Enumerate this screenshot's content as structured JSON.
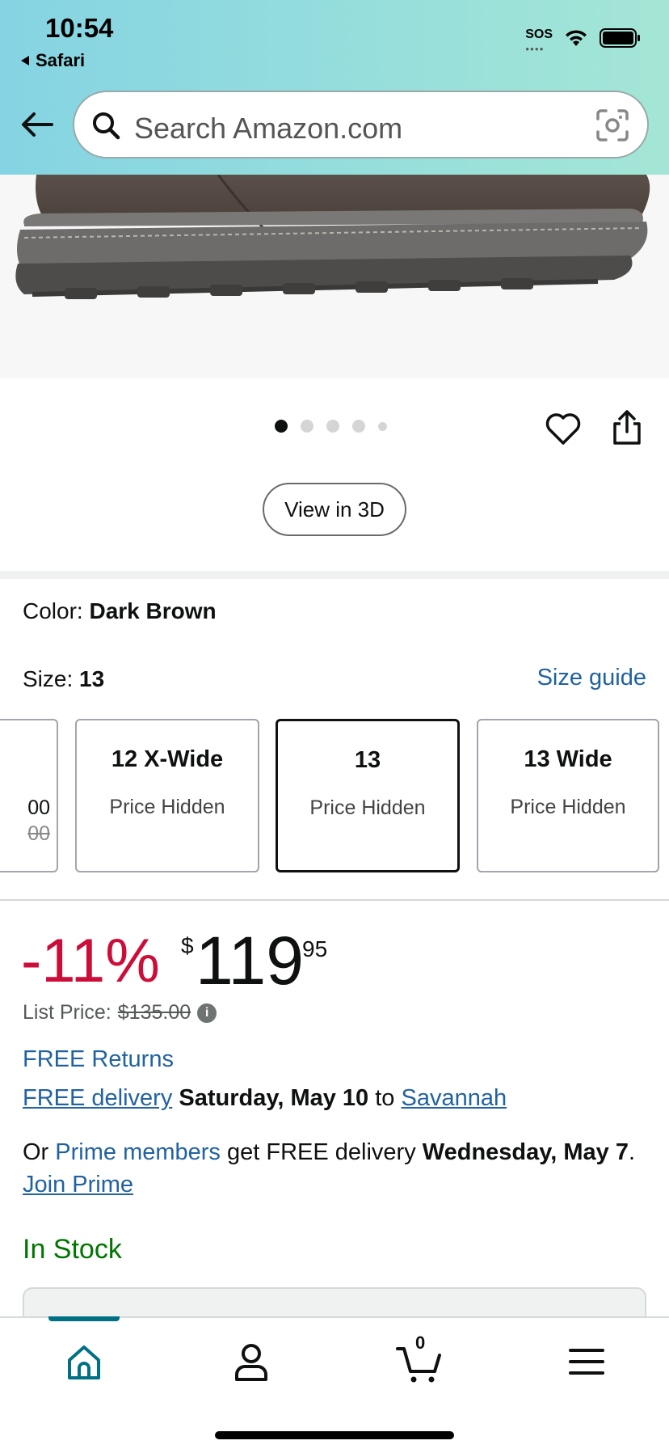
{
  "status_bar": {
    "time": "10:54",
    "back_app": "Safari",
    "sos": "SOS"
  },
  "search": {
    "placeholder": "Search Amazon.com"
  },
  "carousel": {
    "dot_count": 5,
    "active_index": 0
  },
  "view3d_label": "View in 3D",
  "color": {
    "label": "Color: ",
    "value": "Dark Brown"
  },
  "size": {
    "label": "Size: ",
    "value": "13",
    "guide_link": "Size guide",
    "options": [
      {
        "name": "",
        "price": "00",
        "strike": "00"
      },
      {
        "name": "12 X-Wide",
        "price": "Price Hidden"
      },
      {
        "name": "13",
        "price": "Price Hidden",
        "selected": true
      },
      {
        "name": "13 Wide",
        "price": "Price Hidden"
      }
    ]
  },
  "price": {
    "discount": "-11%",
    "currency": "$",
    "whole": "119",
    "fraction": "95",
    "list_label": "List Price: ",
    "list_value": "$135.00",
    "info_icon": "i"
  },
  "delivery": {
    "free_returns": "FREE Returns",
    "free_delivery_link": "FREE delivery",
    "delivery_date": "Saturday, May 10",
    "to_text": "to",
    "location_link": "Savannah",
    "prime_prefix": "Or ",
    "prime_members_link": "Prime members",
    "prime_mid": " get FREE delivery ",
    "prime_date": "Wednesday, May 7",
    "prime_period": ". ",
    "join_prime_link": "Join Prime"
  },
  "stock_status": "In Stock",
  "bottom_nav": {
    "cart_count": "0",
    "items": [
      "home-icon",
      "account-icon",
      "cart-icon",
      "menu-icon"
    ]
  },
  "colors": {
    "header_gradient_start": "#85d4e3",
    "header_gradient_end": "#a4e6d6",
    "link": "#2162a1",
    "discount": "#cc0c39",
    "in_stock": "#007600",
    "nav_active": "#007185"
  }
}
